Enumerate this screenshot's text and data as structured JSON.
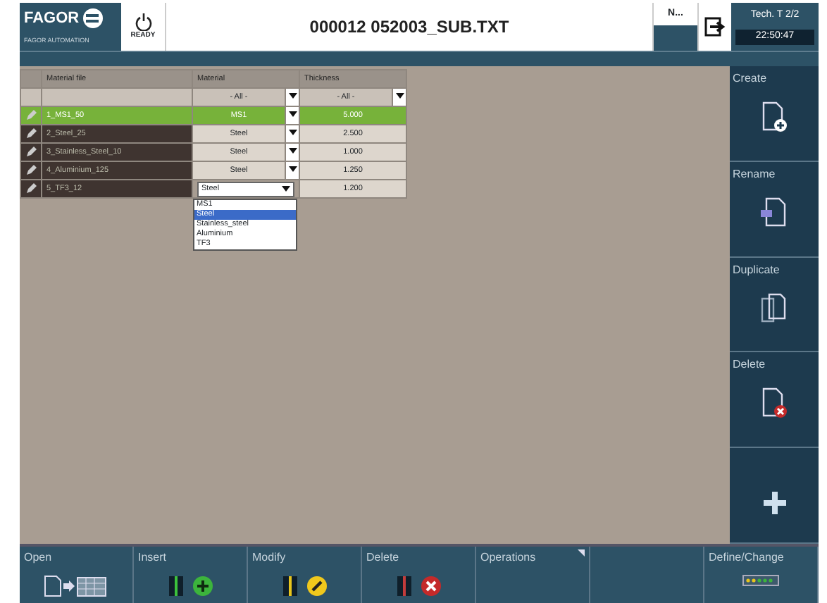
{
  "header": {
    "logo": "FAGOR",
    "logo_sub": "FAGOR AUTOMATION",
    "status": "READY",
    "title": "000012 052003_SUB.TXT",
    "mode": "N...",
    "user": "Tech. T 2/2",
    "time": "22:50:47"
  },
  "table": {
    "columns": [
      "Material file",
      "Material",
      "Thickness"
    ],
    "filters": [
      "- All -",
      "- All -"
    ],
    "rows": [
      {
        "name": "1_MS1_50",
        "material": "MS1",
        "thickness": "5.000",
        "selected": true
      },
      {
        "name": "2_Steel_25",
        "material": "Steel",
        "thickness": "2.500",
        "selected": false
      },
      {
        "name": "3_Stainless_Steel_10",
        "material": "Steel",
        "thickness": "1.000",
        "selected": false
      },
      {
        "name": "4_Aluminium_125",
        "material": "Steel",
        "thickness": "1.250",
        "selected": false
      },
      {
        "name": "5_TF3_12",
        "material": "Steel",
        "thickness": "1.200",
        "selected": false,
        "dropdown": {
          "options": [
            {
              "label": "MS1",
              "selected": false
            },
            {
              "label": "Steel",
              "selected": true
            },
            {
              "label": "Stainless_steel",
              "selected": false
            },
            {
              "label": "Aluminium",
              "selected": false
            },
            {
              "label": "TF3",
              "selected": false
            }
          ]
        }
      }
    ]
  },
  "sidebar": [
    {
      "label": "Create",
      "kind": "create"
    },
    {
      "label": "Rename",
      "kind": "rename"
    },
    {
      "label": "Duplicate",
      "kind": "duplicate"
    },
    {
      "label": "Delete",
      "kind": "delete"
    },
    {
      "kind": "plus"
    }
  ],
  "softkeys": [
    {
      "label": "Open",
      "kind": "open"
    },
    {
      "label": "Insert",
      "kind": "insert"
    },
    {
      "label": "Modify",
      "kind": "modify"
    },
    {
      "label": "Delete",
      "kind": "delete"
    },
    {
      "label": "Operations",
      "kind": "menu"
    },
    {
      "kind": "empty"
    },
    {
      "label": "Define/Change",
      "kind": "define"
    }
  ]
}
